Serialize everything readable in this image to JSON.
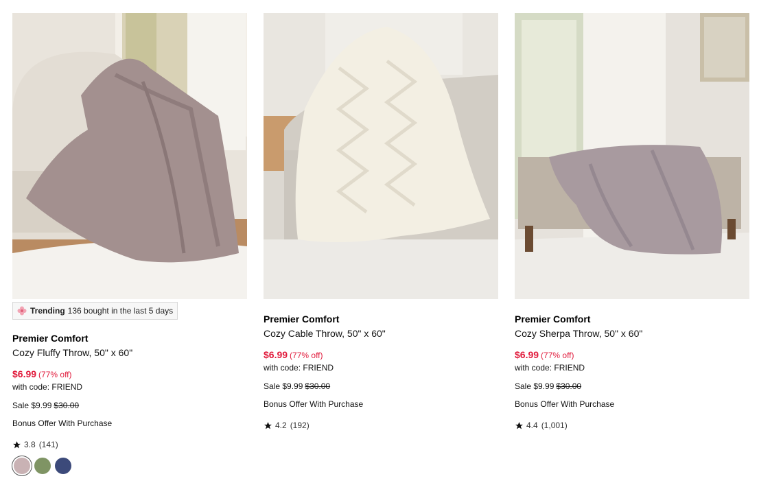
{
  "products": [
    {
      "brand": "Premier Comfort",
      "name": "Cozy Fluffy Throw, 50\" x 60\"",
      "price": "$6.99",
      "discount": "(77% off)",
      "code": "with code: FRIEND",
      "sale_label": "Sale $9.99",
      "original_price": "$30.00",
      "bonus": "Bonus Offer With Purchase",
      "rating": "3.8",
      "reviews": "(141)",
      "trending_label": "Trending",
      "trending_text": "136 bought in the last 5 days",
      "swatches": [
        {
          "color": "#c9b2b4",
          "selected": true
        },
        {
          "color": "#7f9464"
        },
        {
          "color": "#3c4a7a"
        }
      ]
    },
    {
      "brand": "Premier Comfort",
      "name": "Cozy Cable Throw, 50\" x 60\"",
      "price": "$6.99",
      "discount": "(77% off)",
      "code": "with code: FRIEND",
      "sale_label": "Sale $9.99",
      "original_price": "$30.00",
      "bonus": "Bonus Offer With Purchase",
      "rating": "4.2",
      "reviews": "(192)"
    },
    {
      "brand": "Premier Comfort",
      "name": "Cozy Sherpa Throw, 50\" x 60\"",
      "price": "$6.99",
      "discount": "(77% off)",
      "code": "with code: FRIEND",
      "sale_label": "Sale $9.99",
      "original_price": "$30.00",
      "bonus": "Bonus Offer With Purchase",
      "rating": "4.4",
      "reviews": "(1,001)"
    }
  ],
  "colors": {
    "sale_price": "#e11b3c",
    "trending_bg": "#f7f7f7"
  }
}
